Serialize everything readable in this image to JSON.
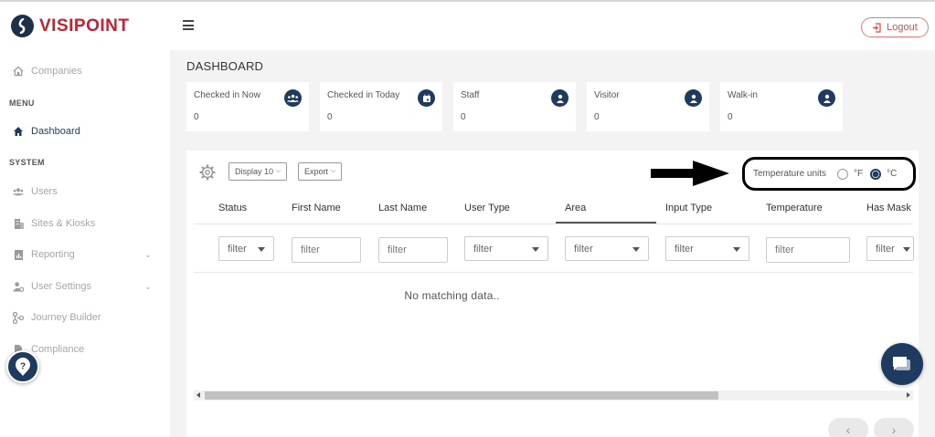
{
  "brand": {
    "name": "VISIPOINT",
    "color": "#c8202f",
    "navy": "#1e3a5f"
  },
  "header": {
    "menu_icon": "hamburger-icon",
    "logout_label": "Logout",
    "logout_icon": "logout-icon"
  },
  "sidebar": {
    "companies": "Companies",
    "menu_heading": "MENU",
    "dashboard": "Dashboard",
    "system_heading": "SYSTEM",
    "users": "Users",
    "sites_kiosks": "Sites & Kiosks",
    "reporting": "Reporting",
    "user_settings": "User Settings",
    "journey_builder": "Journey Builder",
    "compliance": "Compliance"
  },
  "page": {
    "title": "DASHBOARD"
  },
  "cards": [
    {
      "label": "Checked in Now",
      "value": "0",
      "icon": "group-icon"
    },
    {
      "label": "Checked in Today",
      "value": "0",
      "icon": "calendar-icon"
    },
    {
      "label": "Staff",
      "value": "0",
      "icon": "user-icon"
    },
    {
      "label": "Visitor",
      "value": "0",
      "icon": "user-icon"
    },
    {
      "label": "Walk-in",
      "value": "0",
      "icon": "user-icon"
    }
  ],
  "toolbar": {
    "display_label": "Display 10",
    "export_label": "Export"
  },
  "temperature": {
    "label": "Temperature units",
    "option_f": "°F",
    "option_c": "°C",
    "selected": "°C"
  },
  "table": {
    "columns": [
      "Status",
      "First Name",
      "Last Name",
      "User Type",
      "Area",
      "Input Type",
      "Temperature",
      "Has Mask"
    ],
    "filter_placeholder": "filter",
    "empty_message": "No matching data.."
  },
  "pagination": {
    "prev": "‹",
    "next": "›"
  }
}
